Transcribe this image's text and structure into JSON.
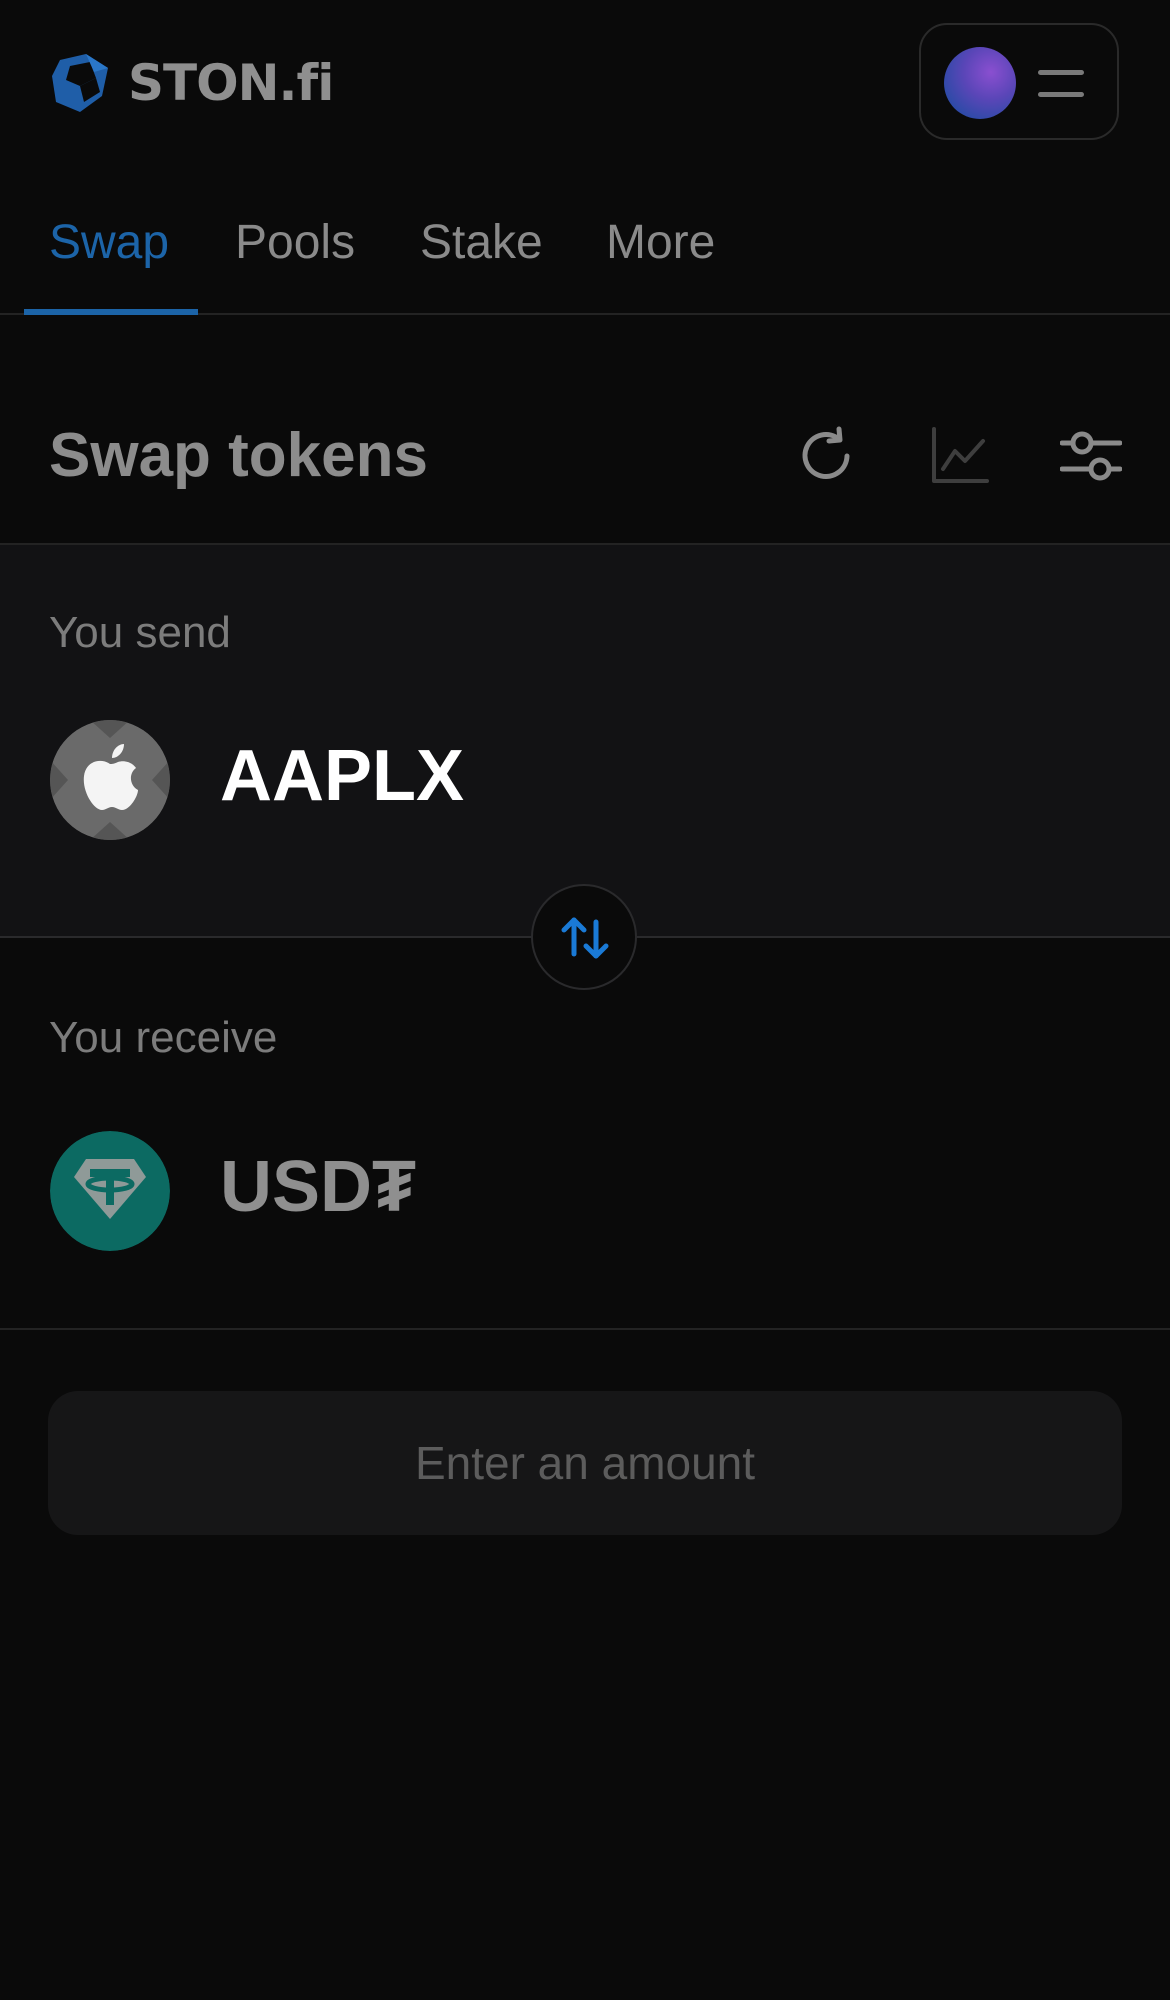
{
  "header": {
    "logo_text": "STON.fi",
    "logo_icon": "ston-logo-icon",
    "avatar_icon": "wallet-avatar",
    "menu_icon": "hamburger-menu-icon"
  },
  "tabs": [
    {
      "label": "Swap",
      "active": true
    },
    {
      "label": "Pools",
      "active": false
    },
    {
      "label": "Stake",
      "active": false
    },
    {
      "label": "More",
      "active": false
    }
  ],
  "swap": {
    "title": "Swap tokens",
    "refresh_icon": "refresh-icon",
    "chart_icon": "chart-icon",
    "settings_icon": "sliders-icon"
  },
  "send": {
    "label": "You send",
    "token": "AAPLX",
    "token_icon": "apple-token-icon"
  },
  "switch_icon": "swap-arrows-icon",
  "receive": {
    "label": "You receive",
    "token": "USD₮",
    "token_icon": "tether-token-icon"
  },
  "action": {
    "label": "Enter an amount"
  },
  "colors": {
    "background": "#0a0a0a",
    "accent": "#1c64a8",
    "send_panel": "#121214",
    "tether": "#0c7a70"
  }
}
